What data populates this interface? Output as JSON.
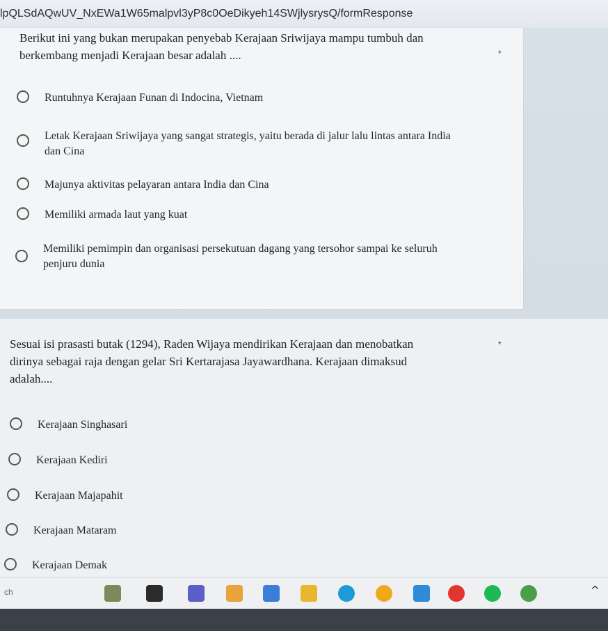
{
  "browser": {
    "url_fragment": "lpQLSdAQwUV_NxEWa1W65malpvl3yP8c0OeDikyeh14SWjlysrysQ/formResponse"
  },
  "questions": [
    {
      "title_line1": "Berikut ini yang bukan merupakan penyebab Kerajaan Sriwijaya mampu tumbuh dan",
      "title_line2": "berkembang menjadi Kerajaan besar adalah ....",
      "required_mark": "*",
      "options": [
        {
          "line1": "Runtuhnya Kerajaan Funan di Indocina, Vietnam",
          "line2": ""
        },
        {
          "line1": "Letak Kerajaan Sriwijaya yang sangat strategis, yaitu berada di jalur lalu lintas antara India",
          "line2": "dan Cina"
        },
        {
          "line1": "Majunya aktivitas pelayaran antara India dan Cina",
          "line2": ""
        },
        {
          "line1": "Memiliki armada laut yang kuat",
          "line2": ""
        },
        {
          "line1": "Memiliki pemimpin dan organisasi persekutuan dagang yang tersohor sampai ke seluruh",
          "line2": "penjuru dunia"
        }
      ]
    },
    {
      "title_line1": "Sesuai isi prasasti butak (1294), Raden Wijaya mendirikan Kerajaan dan menobatkan",
      "title_line2": "dirinya sebagai raja dengan gelar Sri Kertarajasa Jayawardhana. Kerajaan dimaksud",
      "title_line3": "adalah....",
      "required_mark": "*",
      "options": [
        {
          "line1": "Kerajaan Singhasari"
        },
        {
          "line1": "Kerajaan Kediri"
        },
        {
          "line1": "Kerajaan Majapahit"
        },
        {
          "line1": "Kerajaan Mataram"
        },
        {
          "line1": "Kerajaan Demak"
        }
      ]
    }
  ],
  "taskbar": {
    "search_text": "ch",
    "icons": [
      {
        "name": "widgets-icon",
        "color": "#7a8a5a"
      },
      {
        "name": "task-view-icon",
        "color": "#2b2b2b"
      },
      {
        "name": "teams-icon",
        "color": "#5b5fc7"
      },
      {
        "name": "paint-icon",
        "color": "#e8a33a"
      },
      {
        "name": "store-icon",
        "color": "#3a7fd5"
      },
      {
        "name": "file-explorer-icon",
        "color": "#e8b730"
      },
      {
        "name": "edge-icon",
        "color": "#1e9ad6"
      },
      {
        "name": "chrome-canary-icon",
        "color": "#f0a91a"
      },
      {
        "name": "app-icon",
        "color": "#2d8bd8"
      },
      {
        "name": "opera-icon",
        "color": "#e3342f"
      },
      {
        "name": "spotify-icon",
        "color": "#1db954"
      },
      {
        "name": "chrome-icon",
        "color": "#4aa04a"
      }
    ],
    "chevron": "^"
  }
}
